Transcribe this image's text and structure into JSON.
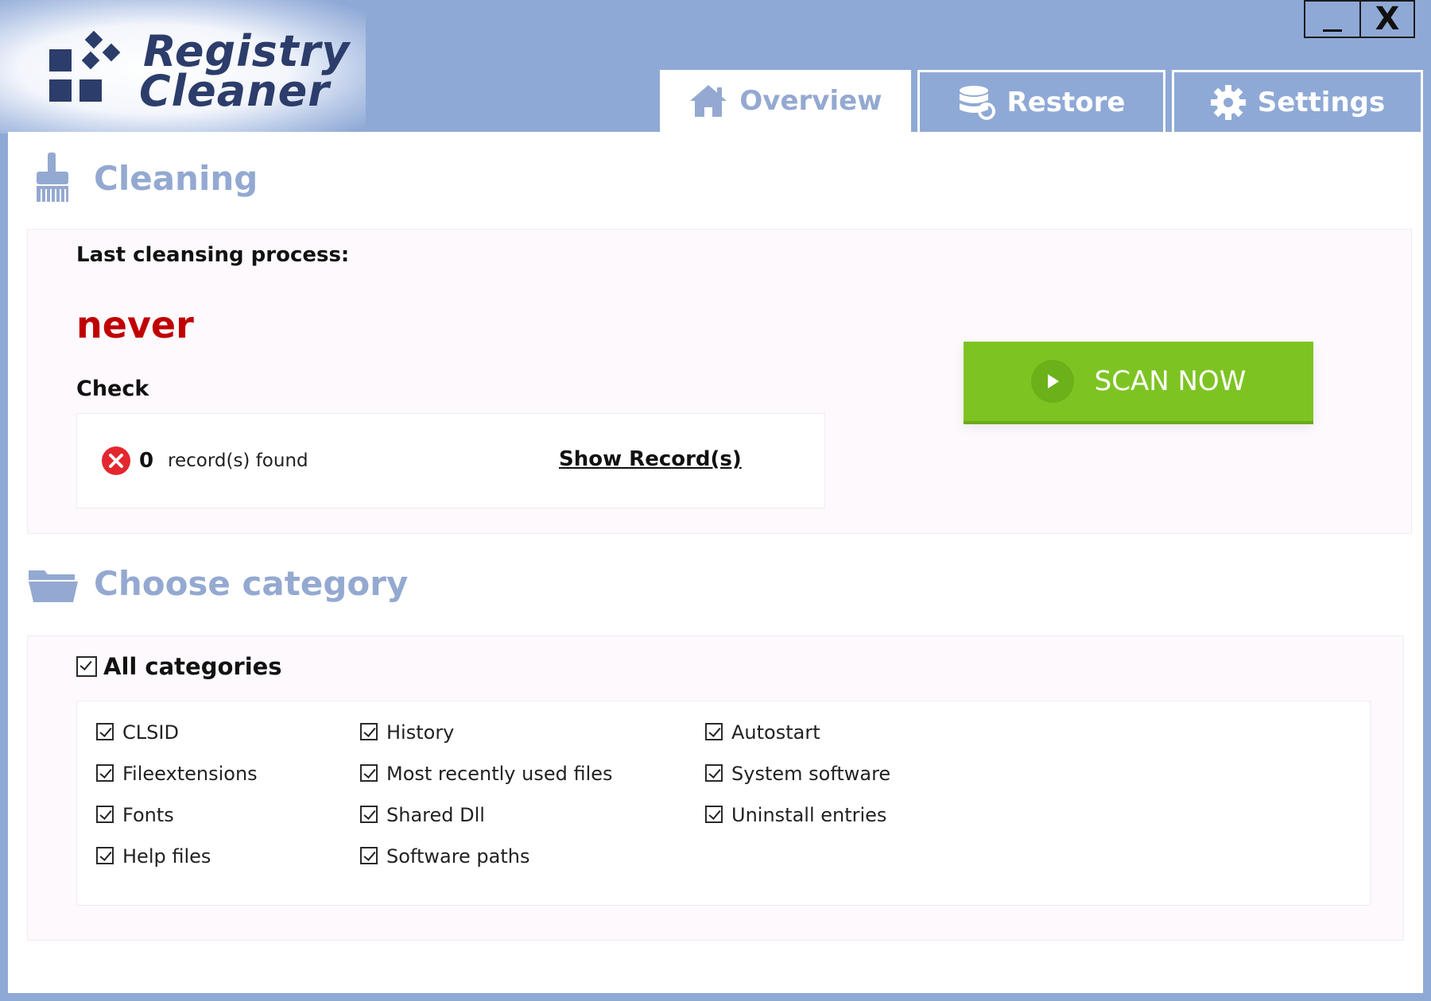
{
  "app": {
    "title_line1": "Registry",
    "title_line2": "Cleaner",
    "minimize_label": "_",
    "close_label": "X"
  },
  "tabs": [
    {
      "label": "Overview",
      "icon": "home-icon",
      "active": true
    },
    {
      "label": "Restore",
      "icon": "database-restore-icon",
      "active": false
    },
    {
      "label": "Settings",
      "icon": "gear-icon",
      "active": false
    }
  ],
  "cleaning": {
    "title": "Cleaning",
    "icon": "brush-icon",
    "last_label": "Last cleansing process:",
    "last_value": "never",
    "check_label": "Check",
    "records_count": "0",
    "records_label": "record(s) found",
    "show_records_label": "Show Record(s)",
    "scan_label": "SCAN NOW"
  },
  "category": {
    "title": "Choose category",
    "icon": "folder-icon",
    "all_label": "All categories",
    "all_checked": true,
    "columns": [
      [
        {
          "label": "CLSID",
          "checked": true
        },
        {
          "label": "Fileextensions",
          "checked": true
        },
        {
          "label": "Fonts",
          "checked": true
        },
        {
          "label": "Help files",
          "checked": true
        }
      ],
      [
        {
          "label": "History",
          "checked": true
        },
        {
          "label": "Most recently used files",
          "checked": true
        },
        {
          "label": "Shared Dll",
          "checked": true
        },
        {
          "label": "Software paths",
          "checked": true
        }
      ],
      [
        {
          "label": "Autostart",
          "checked": true
        },
        {
          "label": "System software",
          "checked": true
        },
        {
          "label": "Uninstall entries",
          "checked": true
        }
      ]
    ]
  },
  "colors": {
    "frame": "#8fa9d6",
    "accent_text": "#94a9d1",
    "never_red": "#c00000",
    "scan_green": "#7dc423",
    "error_red": "#e4262e"
  }
}
